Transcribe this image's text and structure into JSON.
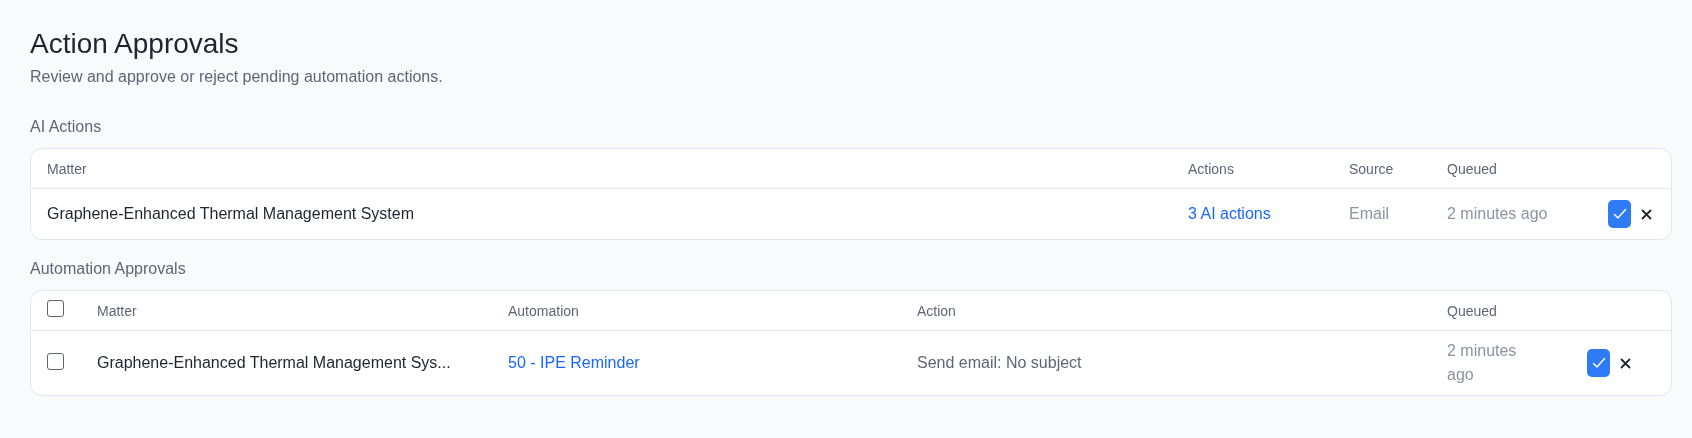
{
  "page": {
    "title": "Action Approvals",
    "subtitle": "Review and approve or reject pending automation actions."
  },
  "ai_actions": {
    "heading": "AI Actions",
    "columns": [
      "Matter",
      "Actions",
      "Source",
      "Queued"
    ],
    "rows": [
      {
        "matter": "Graphene-Enhanced Thermal Management System",
        "actions": "3 AI actions",
        "source": "Email",
        "queued": "2 minutes ago"
      }
    ]
  },
  "automation_approvals": {
    "heading": "Automation Approvals",
    "select_all": {
      "checked": false
    },
    "columns": [
      "Matter",
      "Automation",
      "Action",
      "Queued"
    ],
    "rows": [
      {
        "checked": false,
        "matter": "Graphene-Enhanced Thermal Management Sys...",
        "automation": "50 - IPE Reminder",
        "action": "Send email: No subject",
        "queued": "2 minutes ago"
      }
    ]
  }
}
